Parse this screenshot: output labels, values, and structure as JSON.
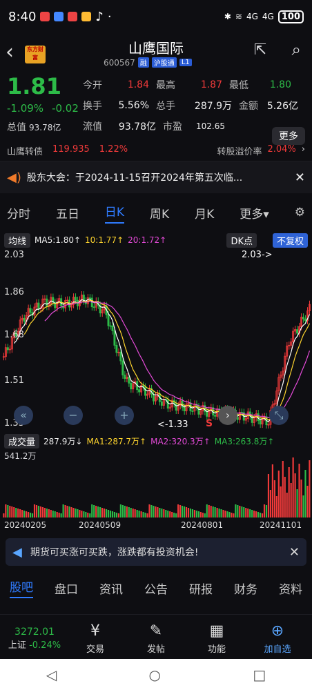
{
  "status": {
    "time": "8:40",
    "signal1": "4G",
    "signal2": "4G",
    "battery": "100"
  },
  "header": {
    "logo": "东方财富",
    "name": "山鹰国际",
    "code": "600567",
    "tag1": "融",
    "tag2": "沪股通",
    "tag3": "L1"
  },
  "quote": {
    "price": "1.81",
    "pct": "-1.09%",
    "chg": "-0.02",
    "mcap_label": "总值",
    "mcap": "93.78亿",
    "open_l": "今开",
    "open": "1.84",
    "high_l": "最高",
    "high": "1.87",
    "low_l": "最低",
    "low": "1.80",
    "turn_l": "换手",
    "turn": "5.56%",
    "vol_l": "总手",
    "vol": "287.9万",
    "amt_l": "金额",
    "amt": "5.26亿",
    "float_l": "流值",
    "float": "93.78亿",
    "pe_l": "市盈",
    "pe": "102.65",
    "more": "更多"
  },
  "bond": {
    "name": "山鹰转债",
    "price": "119.935",
    "pct": "1.22%",
    "prem_l": "转股溢价率",
    "prem": "2.04%",
    "chev": "›"
  },
  "notice": {
    "text": "股东大会：于2024-11-15召开2024年第五次临..."
  },
  "ktabs": [
    "分时",
    "五日",
    "日K",
    "周K",
    "月K",
    "更多"
  ],
  "ma": {
    "btn": "均线",
    "ma5": "MA5:1.80↑",
    "ma10": "10:1.77↑",
    "ma20": "20:1.72↑",
    "dk": "DK点",
    "fq": "不复权",
    "hi": "2.03->",
    "lo": "<-1.33",
    "s": "S"
  },
  "yaxis": [
    "2.03",
    "1.86",
    "1.68",
    "1.51",
    "1.33"
  ],
  "volume": {
    "btn": "成交量",
    "val": "287.9万↓",
    "ma1": "MA1:287.7万↑",
    "ma2": "MA2:320.3万↑",
    "ma3": "MA3:263.8万↑",
    "max": "541.2万"
  },
  "dates": [
    "20240205",
    "20240509",
    "20240801",
    "20241101"
  ],
  "ad": {
    "text": "期货可买涨可买跌，涨跌都有投资机会!"
  },
  "btabs": [
    "股吧",
    "盘口",
    "资讯",
    "公告",
    "研报",
    "财务",
    "资料"
  ],
  "nav": {
    "index_val": "3272.01",
    "index_name": "上证",
    "index_pct": "-0.24%",
    "trade": "交易",
    "post": "发帖",
    "func": "功能",
    "add": "加自选"
  },
  "chart_data": {
    "type": "candlestick",
    "ylim": [
      1.33,
      2.03
    ],
    "max_label": "2.03",
    "min_label": "1.33",
    "x": [
      "20240205",
      "20240509",
      "20240801",
      "20241101"
    ],
    "close_approx": [
      1.62,
      1.78,
      1.84,
      1.83,
      1.85,
      1.8,
      1.52,
      1.48,
      1.43,
      1.42,
      1.4,
      1.39,
      1.38,
      1.36,
      1.68,
      1.81
    ]
  }
}
